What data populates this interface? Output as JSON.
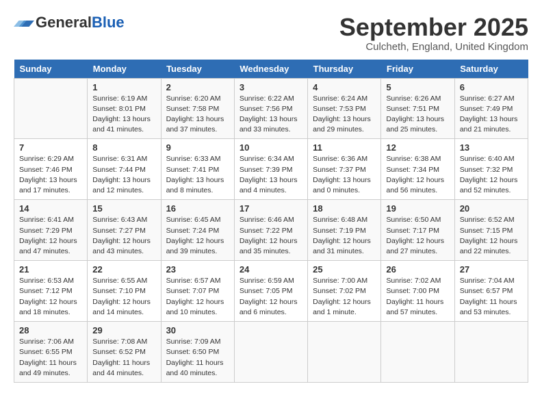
{
  "logo": {
    "general": "General",
    "blue": "Blue"
  },
  "title": "September 2025",
  "subtitle": "Culcheth, England, United Kingdom",
  "headers": [
    "Sunday",
    "Monday",
    "Tuesday",
    "Wednesday",
    "Thursday",
    "Friday",
    "Saturday"
  ],
  "weeks": [
    [
      {
        "day": "",
        "info": ""
      },
      {
        "day": "1",
        "info": "Sunrise: 6:19 AM\nSunset: 8:01 PM\nDaylight: 13 hours\nand 41 minutes."
      },
      {
        "day": "2",
        "info": "Sunrise: 6:20 AM\nSunset: 7:58 PM\nDaylight: 13 hours\nand 37 minutes."
      },
      {
        "day": "3",
        "info": "Sunrise: 6:22 AM\nSunset: 7:56 PM\nDaylight: 13 hours\nand 33 minutes."
      },
      {
        "day": "4",
        "info": "Sunrise: 6:24 AM\nSunset: 7:53 PM\nDaylight: 13 hours\nand 29 minutes."
      },
      {
        "day": "5",
        "info": "Sunrise: 6:26 AM\nSunset: 7:51 PM\nDaylight: 13 hours\nand 25 minutes."
      },
      {
        "day": "6",
        "info": "Sunrise: 6:27 AM\nSunset: 7:49 PM\nDaylight: 13 hours\nand 21 minutes."
      }
    ],
    [
      {
        "day": "7",
        "info": "Sunrise: 6:29 AM\nSunset: 7:46 PM\nDaylight: 13 hours\nand 17 minutes."
      },
      {
        "day": "8",
        "info": "Sunrise: 6:31 AM\nSunset: 7:44 PM\nDaylight: 13 hours\nand 12 minutes."
      },
      {
        "day": "9",
        "info": "Sunrise: 6:33 AM\nSunset: 7:41 PM\nDaylight: 13 hours\nand 8 minutes."
      },
      {
        "day": "10",
        "info": "Sunrise: 6:34 AM\nSunset: 7:39 PM\nDaylight: 13 hours\nand 4 minutes."
      },
      {
        "day": "11",
        "info": "Sunrise: 6:36 AM\nSunset: 7:37 PM\nDaylight: 13 hours\nand 0 minutes."
      },
      {
        "day": "12",
        "info": "Sunrise: 6:38 AM\nSunset: 7:34 PM\nDaylight: 12 hours\nand 56 minutes."
      },
      {
        "day": "13",
        "info": "Sunrise: 6:40 AM\nSunset: 7:32 PM\nDaylight: 12 hours\nand 52 minutes."
      }
    ],
    [
      {
        "day": "14",
        "info": "Sunrise: 6:41 AM\nSunset: 7:29 PM\nDaylight: 12 hours\nand 47 minutes."
      },
      {
        "day": "15",
        "info": "Sunrise: 6:43 AM\nSunset: 7:27 PM\nDaylight: 12 hours\nand 43 minutes."
      },
      {
        "day": "16",
        "info": "Sunrise: 6:45 AM\nSunset: 7:24 PM\nDaylight: 12 hours\nand 39 minutes."
      },
      {
        "day": "17",
        "info": "Sunrise: 6:46 AM\nSunset: 7:22 PM\nDaylight: 12 hours\nand 35 minutes."
      },
      {
        "day": "18",
        "info": "Sunrise: 6:48 AM\nSunset: 7:19 PM\nDaylight: 12 hours\nand 31 minutes."
      },
      {
        "day": "19",
        "info": "Sunrise: 6:50 AM\nSunset: 7:17 PM\nDaylight: 12 hours\nand 27 minutes."
      },
      {
        "day": "20",
        "info": "Sunrise: 6:52 AM\nSunset: 7:15 PM\nDaylight: 12 hours\nand 22 minutes."
      }
    ],
    [
      {
        "day": "21",
        "info": "Sunrise: 6:53 AM\nSunset: 7:12 PM\nDaylight: 12 hours\nand 18 minutes."
      },
      {
        "day": "22",
        "info": "Sunrise: 6:55 AM\nSunset: 7:10 PM\nDaylight: 12 hours\nand 14 minutes."
      },
      {
        "day": "23",
        "info": "Sunrise: 6:57 AM\nSunset: 7:07 PM\nDaylight: 12 hours\nand 10 minutes."
      },
      {
        "day": "24",
        "info": "Sunrise: 6:59 AM\nSunset: 7:05 PM\nDaylight: 12 hours\nand 6 minutes."
      },
      {
        "day": "25",
        "info": "Sunrise: 7:00 AM\nSunset: 7:02 PM\nDaylight: 12 hours\nand 1 minute."
      },
      {
        "day": "26",
        "info": "Sunrise: 7:02 AM\nSunset: 7:00 PM\nDaylight: 11 hours\nand 57 minutes."
      },
      {
        "day": "27",
        "info": "Sunrise: 7:04 AM\nSunset: 6:57 PM\nDaylight: 11 hours\nand 53 minutes."
      }
    ],
    [
      {
        "day": "28",
        "info": "Sunrise: 7:06 AM\nSunset: 6:55 PM\nDaylight: 11 hours\nand 49 minutes."
      },
      {
        "day": "29",
        "info": "Sunrise: 7:08 AM\nSunset: 6:52 PM\nDaylight: 11 hours\nand 44 minutes."
      },
      {
        "day": "30",
        "info": "Sunrise: 7:09 AM\nSunset: 6:50 PM\nDaylight: 11 hours\nand 40 minutes."
      },
      {
        "day": "",
        "info": ""
      },
      {
        "day": "",
        "info": ""
      },
      {
        "day": "",
        "info": ""
      },
      {
        "day": "",
        "info": ""
      }
    ]
  ]
}
